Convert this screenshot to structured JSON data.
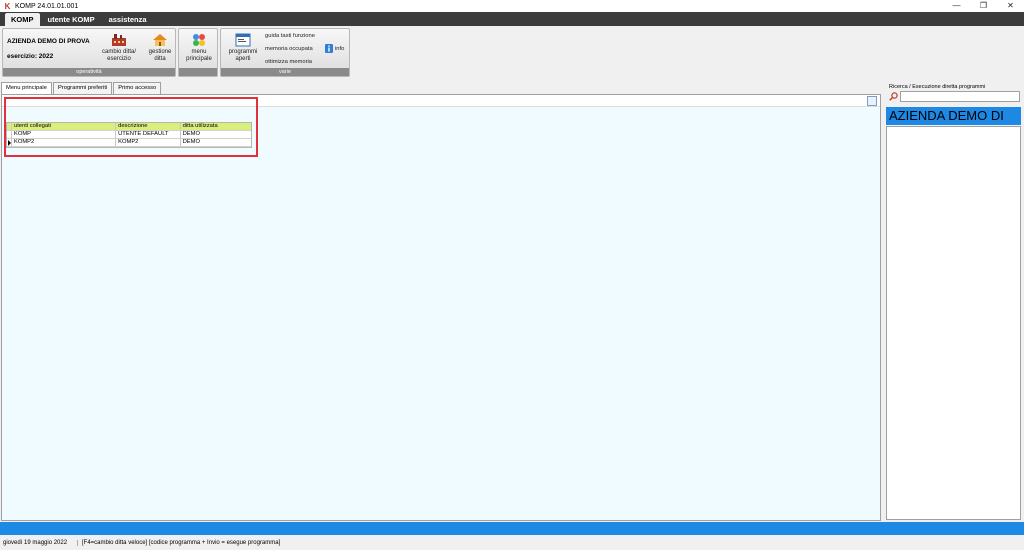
{
  "window": {
    "title": "KOMP 24.01.01.001",
    "controls": {
      "minimize": "—",
      "restore": "❐",
      "close": "✕"
    }
  },
  "ribbon_tabs": [
    "KOMP",
    "utente KOMP",
    "assistenza"
  ],
  "ribbon": {
    "company_name": "AZIENDA DEMO DI PROVA",
    "fiscal_year": "esercizio: 2022",
    "group_operativita": "operatività",
    "group_varie": "varie",
    "cambio_ditta": "cambio ditta/ esercizio",
    "gestione_ditta": "gestione ditta",
    "menu_principale": "menu principale",
    "programmi_aperti": "programmi aperti",
    "guida_tasti": "guida tasti funzione",
    "memoria_occupata": "memoria occupata",
    "ottimizza_memoria": "ottimizza memoria",
    "info": "info"
  },
  "content_tabs": [
    "Menu principale",
    "Programmi preferiti",
    "Primo accesso"
  ],
  "grid": {
    "headers": [
      "utenti collegati",
      "descrizione",
      "ditta utilizzata"
    ],
    "rows": [
      [
        "KOMP",
        "UTENTE DEFAULT",
        "DEMO"
      ],
      [
        "KOMP2",
        "KOMP2",
        "DEMO"
      ]
    ]
  },
  "right_panel": {
    "search_label": "Ricerca / Esecuzione diretta programmi",
    "search_value": "",
    "company_banner": "AZIENDA DEMO DI"
  },
  "status": {
    "date": "giovedì 19 maggio 2022",
    "hint": "[F4=cambio ditta veloce] [codice programma + Invio = esegue programma]"
  },
  "colors": {
    "accent_blue": "#1e88e5",
    "grid_header": "#d9ef7c",
    "highlight": "#e0303a",
    "ribbon_dark": "#3c3c3c"
  }
}
